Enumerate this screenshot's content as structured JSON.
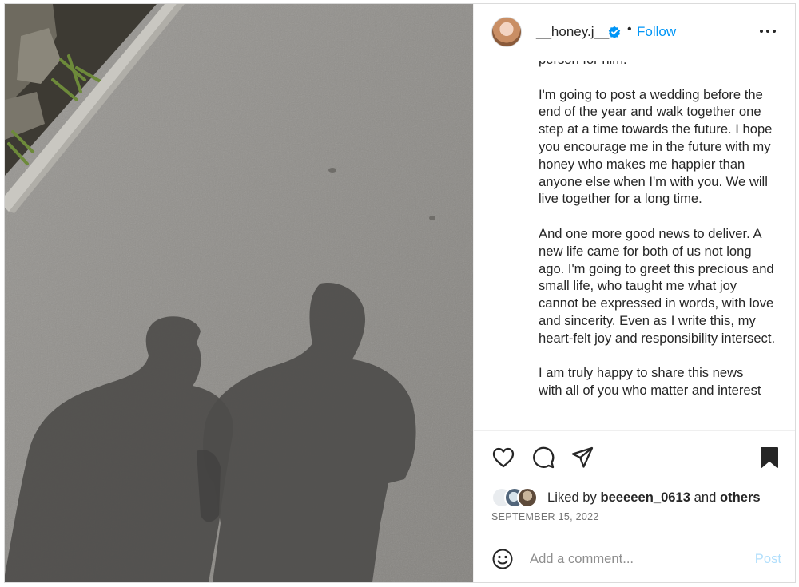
{
  "post": {
    "username": "__honey.j__",
    "verified": true,
    "separator": "•",
    "follow_label": "Follow",
    "more_icon": "more-horizontal-icon",
    "caption_paragraphs": [
      "person for him.",
      "I'm going to post a wedding before the end of the year and walk together one step at a time towards the future. I hope you encourage me in the future with my honey who makes me happier than anyone else when I'm with you. We will live together for a long time.",
      "And one more good news to deliver. A new life came for both of us not long ago. I'm going to greet this precious and small life, who taught me what joy cannot be expressed in words, with love and sincerity. Even as I write this, my heart-felt joy and responsibility intersect.",
      "I am truly happy to share this news",
      "with all of you who matter and interest"
    ],
    "actions": {
      "like_icon": "heart-icon",
      "comment_icon": "comment-icon",
      "share_icon": "send-icon",
      "save_icon": "bookmark-icon"
    },
    "likes": {
      "prefix": "Liked by",
      "user": "beeeeen_0613",
      "connector": "and",
      "others": "others"
    },
    "date": "SEPTEMBER 15, 2022",
    "comment": {
      "placeholder": "Add a comment...",
      "post_label": "Post",
      "emoji_icon": "smiley-icon"
    }
  },
  "colors": {
    "link": "#0095f6",
    "post_disabled": "#b2dffc",
    "muted": "#737373",
    "text": "#262626"
  }
}
